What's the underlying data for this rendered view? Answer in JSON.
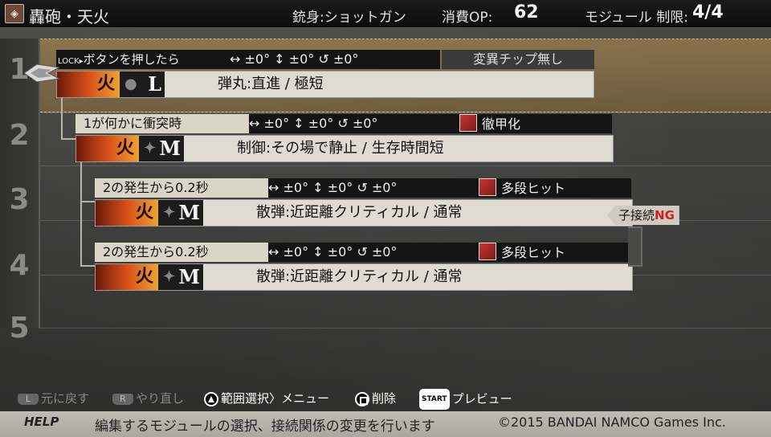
{
  "header": {
    "bullet_name": "轟砲・天火",
    "barrel_label": "銃身:ショットガン",
    "op_label": "消費OP:",
    "op_value": "62",
    "module_limit_label": "モジュール 制限:",
    "module_limit_value": "4/4"
  },
  "row_numbers": [
    "1",
    "2",
    "3",
    "4",
    "5"
  ],
  "modules": [
    {
      "condition_prefix": "LOCK▸",
      "condition": "ボタンを押したら",
      "angles": "↔ ±0°  ↕ ±0°  ↺ ±0°",
      "chip": "変異チップ無し",
      "element": "火",
      "size": "L",
      "description": "弾丸:直進 / 極短"
    },
    {
      "condition": "1が何かに衝突時",
      "angles": "↔ ±0°  ↕ ±0°  ↺ ±0°",
      "chip": "徹甲化",
      "element": "火",
      "size": "M",
      "description": "制御:その場で静止 / 生存時間短"
    },
    {
      "condition": "2の発生から0.2秒",
      "angles": "↔ ±0°  ↕ ±0°  ↺ ±0°",
      "chip": "多段ヒット",
      "element": "火",
      "size": "M",
      "description": "散弾:近距離クリティカル / 通常"
    },
    {
      "condition": "2の発生から0.2秒",
      "angles": "↔ ±0°  ↕ ±0°  ↺ ±0°",
      "chip": "多段ヒット",
      "element": "火",
      "size": "M",
      "description": "散弾:近距離クリティカル / 通常"
    }
  ],
  "child_connect": {
    "label": "子接続",
    "status": "NG"
  },
  "controls": {
    "undo": "元に戻す",
    "redo": "やり直し",
    "range_select": "範囲選択〉メニュー",
    "delete": "削除",
    "preview": "プレビュー"
  },
  "help": {
    "tag": "HELP",
    "text": "編集するモジュールの選択、接続関係の変更を行います",
    "copyright": "©2015 BANDAI NAMCO Games Inc."
  },
  "colors": {
    "accent_ng": "#d02020",
    "row_highlight": "#b8904c"
  }
}
